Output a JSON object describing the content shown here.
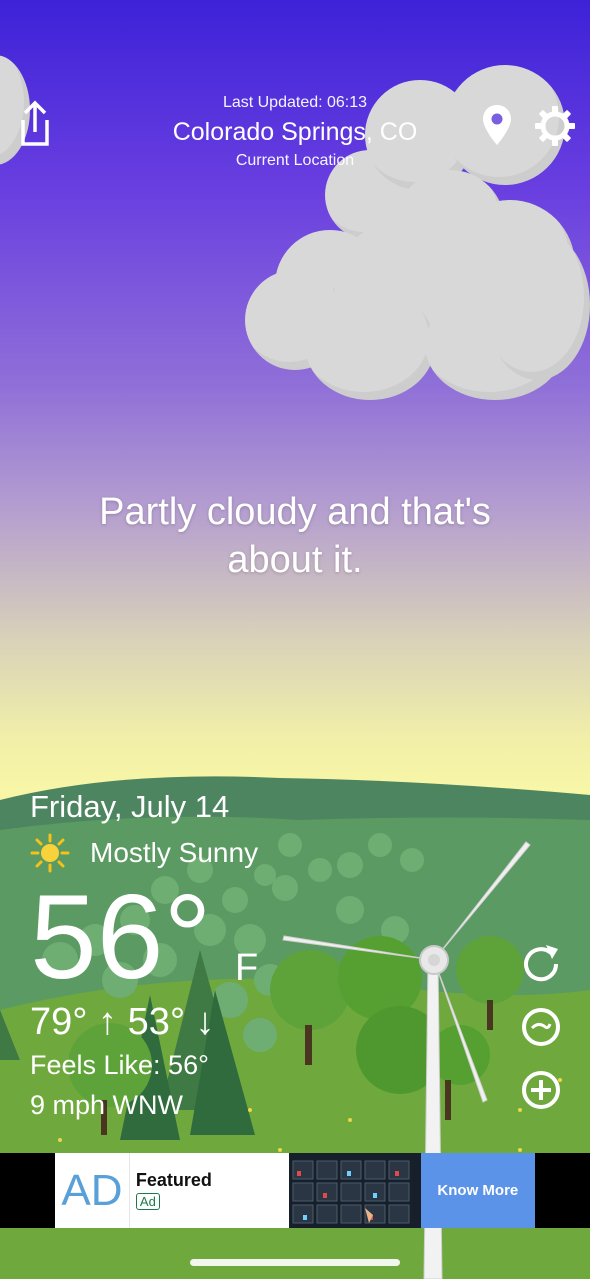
{
  "header": {
    "last_updated": "Last Updated: 06:13",
    "city": "Colorado Springs, CO",
    "location_label": "Current Location"
  },
  "headline": "Partly cloudy and that's about it.",
  "weather": {
    "date": "Friday, July 14",
    "condition": "Mostly Sunny",
    "temperature": "56°",
    "unit": "F",
    "hi_lo": "79° ↑ 53° ↓",
    "feels_like": "Feels Like: 56°",
    "wind": "9 mph WNW"
  },
  "ad": {
    "logo": "AD",
    "title": "Featured",
    "badge": "Ad",
    "cta": "Know More"
  },
  "icons": {
    "share": "share-icon",
    "pin": "location-pin-icon",
    "settings": "gear-icon",
    "refresh": "refresh-icon",
    "radar": "radar-icon",
    "add": "add-icon",
    "sun": "sun-icon"
  },
  "colors": {
    "sky_top": "#3d22d8",
    "sky_bottom": "#fbf9a6",
    "grass": "#72a83a",
    "ad_cta": "#5b93e8"
  }
}
